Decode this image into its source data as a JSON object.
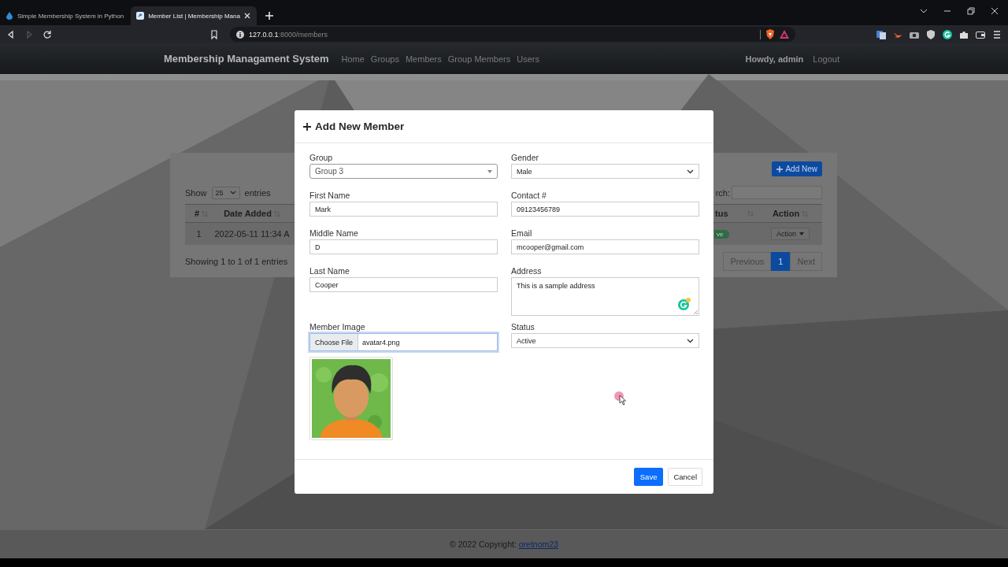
{
  "browser": {
    "tabs": [
      {
        "title": "Simple Membership System in Python",
        "selected": false
      },
      {
        "title": "Member List | Membership Mana",
        "selected": true
      }
    ],
    "url_host": "127.0.0.1",
    "url_rest": ":8000/members"
  },
  "navbar": {
    "brand": "Membership Managament System",
    "links": [
      "Home",
      "Groups",
      "Members",
      "Group Members",
      "Users"
    ],
    "greeting": "Howdy, admin",
    "logout": "Logout"
  },
  "card": {
    "add_button": "Add New",
    "show_label": "Show",
    "page_size": "25",
    "entries_label": "entries",
    "search_label": "rch:",
    "columns": [
      "#",
      "Date Added",
      "tus",
      "Action"
    ],
    "rows": [
      {
        "number": "1",
        "date": "2022-05-11 11:34 A",
        "status": "ve",
        "action": "Action"
      }
    ],
    "info": "Showing 1 to 1 of 1 entries",
    "pagination": [
      {
        "label": "Previous",
        "selected": false
      },
      {
        "label": "1",
        "selected": true
      },
      {
        "label": "Next",
        "selected": false
      }
    ]
  },
  "modal": {
    "title": "Add New Member",
    "left_fields": [
      {
        "kind": "combo",
        "label": "Group",
        "value": "Group 3"
      },
      {
        "kind": "text",
        "label": "First Name",
        "value": "Mark"
      },
      {
        "kind": "text",
        "label": "Middle Name",
        "value": "D"
      },
      {
        "kind": "text",
        "label": "Last Name",
        "value": "Cooper"
      },
      {
        "kind": "file",
        "label": "Member Image",
        "button": "Choose File",
        "value": "avatar4.png"
      }
    ],
    "right_fields": [
      {
        "kind": "select",
        "label": "Gender",
        "value": "Male"
      },
      {
        "kind": "text",
        "label": "Contact #",
        "value": "09123456789"
      },
      {
        "kind": "text",
        "label": "Email",
        "value": "mcooper@gmail.com"
      },
      {
        "kind": "textarea",
        "label": "Address",
        "value": "This is a sample address"
      },
      {
        "kind": "select",
        "label": "Status",
        "value": "Active"
      }
    ],
    "buttons": [
      {
        "kind": "primary",
        "label": "Save"
      },
      {
        "kind": "secondary",
        "label": "Cancel"
      }
    ]
  },
  "footer": {
    "text": "© 2022 Copyright: ",
    "link": "oretnom23"
  }
}
